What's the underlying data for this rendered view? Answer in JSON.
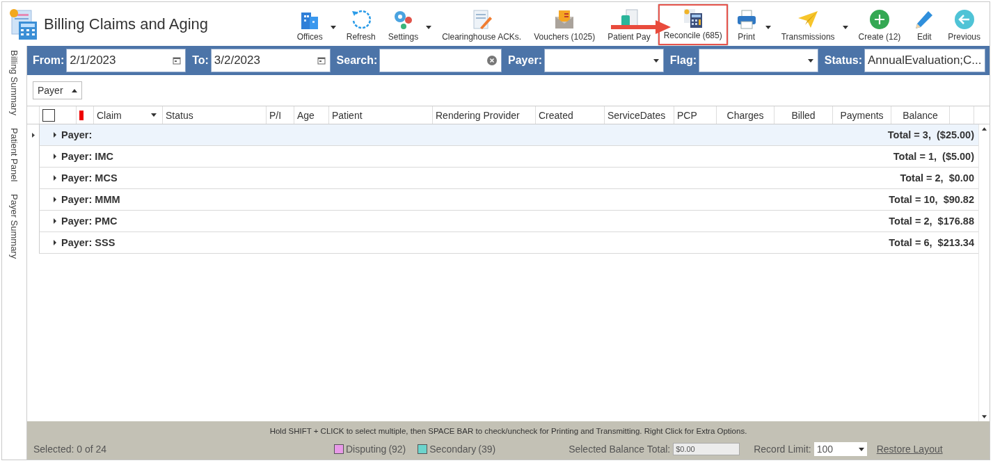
{
  "window": {
    "title": "Billing Claims and Aging"
  },
  "toolbar": [
    {
      "label": "Offices",
      "dropdown": true,
      "highlighted": false
    },
    {
      "label": "Refresh",
      "dropdown": false,
      "highlighted": false
    },
    {
      "label": "Settings",
      "dropdown": true,
      "highlighted": false
    },
    {
      "label": "Clearinghouse ACKs.",
      "dropdown": false,
      "highlighted": false
    },
    {
      "label": "Vouchers (1025)",
      "dropdown": false,
      "highlighted": false
    },
    {
      "label": "Patient Pay",
      "dropdown": false,
      "highlighted": false
    },
    {
      "label": "Reconcile (685)",
      "dropdown": false,
      "highlighted": true
    },
    {
      "label": "Print",
      "dropdown": true,
      "highlighted": false
    },
    {
      "label": "Transmissions",
      "dropdown": true,
      "highlighted": false
    },
    {
      "label": "Create (12)",
      "dropdown": false,
      "highlighted": false
    },
    {
      "label": "Edit",
      "dropdown": false,
      "highlighted": false
    },
    {
      "label": "Previous",
      "dropdown": false,
      "highlighted": false
    }
  ],
  "side_tabs": [
    {
      "label": "Billing Summary"
    },
    {
      "label": "Patient Panel"
    },
    {
      "label": "Payer Summary"
    }
  ],
  "filters": [
    {
      "kind": "date",
      "label": "From:",
      "value": "2/1/2023"
    },
    {
      "kind": "date",
      "label": "To:",
      "value": "3/2/2023"
    },
    {
      "kind": "search",
      "label": "Search:"
    },
    {
      "kind": "dropdown",
      "label": "Payer:"
    },
    {
      "kind": "dropdown",
      "label": "Flag:"
    },
    {
      "kind": "dropdown",
      "label": "Status:",
      "value": "AnnualEvaluation;C..."
    }
  ],
  "group_by": {
    "label": "Payer"
  },
  "table": {
    "select_all_checked": false,
    "columns": [
      {
        "label": "Claim",
        "filter": true
      },
      {
        "label": "Status",
        "filter": false
      },
      {
        "label": "P/I",
        "filter": false
      },
      {
        "label": "Age",
        "filter": false
      },
      {
        "label": "Patient",
        "filter": false
      },
      {
        "label": "Rendering Provider",
        "filter": false
      },
      {
        "label": "Created",
        "filter": false
      },
      {
        "label": "ServiceDates",
        "filter": false
      },
      {
        "label": "PCP",
        "filter": false
      },
      {
        "label": "Charges",
        "filter": false
      },
      {
        "label": "Billed",
        "filter": false
      },
      {
        "label": "Payments",
        "filter": false
      },
      {
        "label": "Balance",
        "filter": false
      }
    ],
    "groups": [
      {
        "label": "Payer:",
        "total": "Total = 3,  ($25.00)",
        "selected": true,
        "expanded": false
      },
      {
        "label": "Payer: IMC",
        "total": "Total = 1,  ($5.00)",
        "selected": false,
        "expanded": false
      },
      {
        "label": "Payer: MCS",
        "total": "Total = 2,  $0.00",
        "selected": false,
        "expanded": false
      },
      {
        "label": "Payer: MMM",
        "total": "Total = 10,  $90.82",
        "selected": false,
        "expanded": false
      },
      {
        "label": "Payer: PMC",
        "total": "Total = 2,  $176.88",
        "selected": false,
        "expanded": false
      },
      {
        "label": "Payer: SSS",
        "total": "Total = 6,  $213.34",
        "selected": false,
        "expanded": false
      }
    ]
  },
  "status_bar": {
    "hint": "Hold SHIFT + CLICK to select multiple, then SPACE BAR to check/uncheck for Printing and Transmitting. Right Click for Extra Options.",
    "selected": "Selected: 0 of 24",
    "legend": [
      {
        "label": "Disputing",
        "count": "(92)",
        "color": "#e89ae8"
      },
      {
        "label": "Secondary",
        "count": "(39)",
        "color": "#6cd4cc"
      }
    ],
    "balance_label": "Selected Balance Total:",
    "balance_value": "$0.00",
    "record_limit_label": "Record Limit:",
    "record_limit": "100",
    "restore": "Restore Layout"
  }
}
